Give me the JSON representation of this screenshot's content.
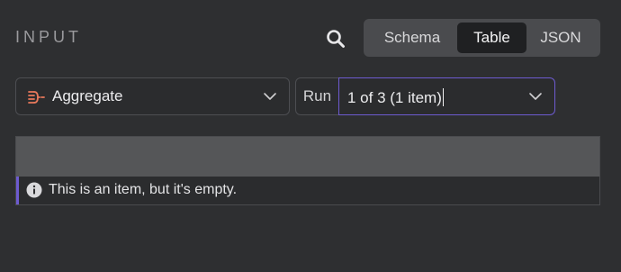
{
  "panel": {
    "title": "INPUT"
  },
  "header": {
    "search_icon": "search-icon",
    "tabs": [
      {
        "label": "Schema",
        "active": false
      },
      {
        "label": "Table",
        "active": true
      },
      {
        "label": "JSON",
        "active": false
      }
    ]
  },
  "node_selector": {
    "icon": "aggregate-node-icon",
    "label": "Aggregate",
    "icon_color": "#e8785b"
  },
  "run_selector": {
    "label": "Run",
    "value": "1 of 3 (1 item)",
    "focus_color": "#6d5bd0"
  },
  "table": {
    "empty_message": "This is an item, but it's empty."
  }
}
